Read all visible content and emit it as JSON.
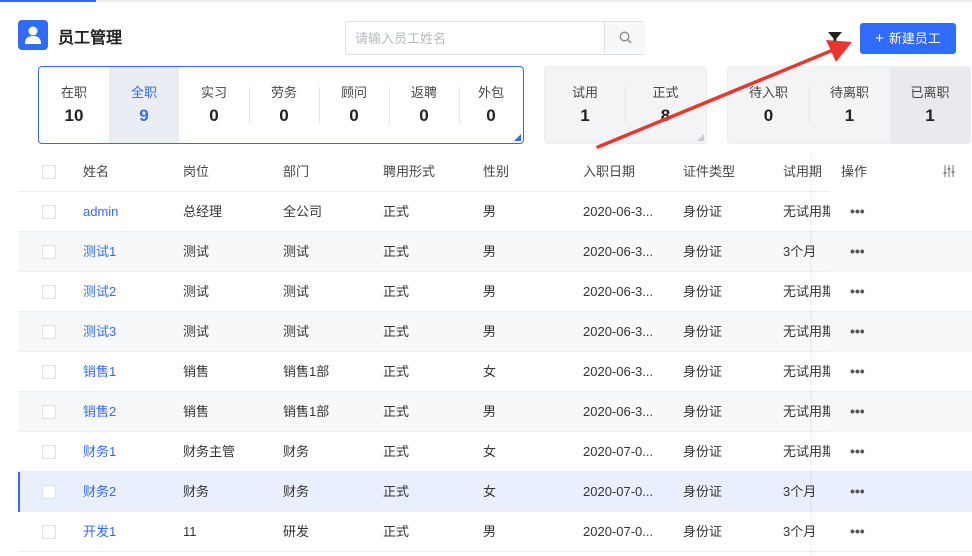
{
  "header": {
    "title": "员工管理",
    "search_placeholder": "请输入员工姓名",
    "new_button_label": "新建员工"
  },
  "stats": {
    "group1": [
      {
        "label": "在职",
        "value": "10"
      },
      {
        "label": "全职",
        "value": "9"
      },
      {
        "label": "实习",
        "value": "0"
      },
      {
        "label": "劳务",
        "value": "0"
      },
      {
        "label": "顾问",
        "value": "0"
      },
      {
        "label": "返聘",
        "value": "0"
      },
      {
        "label": "外包",
        "value": "0"
      }
    ],
    "group2": [
      {
        "label": "试用",
        "value": "1"
      },
      {
        "label": "正式",
        "value": "8"
      }
    ],
    "group3": [
      {
        "label": "待入职",
        "value": "0"
      },
      {
        "label": "待离职",
        "value": "1"
      },
      {
        "label": "已离职",
        "value": "1"
      }
    ]
  },
  "table": {
    "columns": [
      "姓名",
      "岗位",
      "部门",
      "聘用形式",
      "性别",
      "入职日期",
      "证件类型",
      "试用期",
      "操作"
    ],
    "rows": [
      [
        "admin",
        "总经理",
        "全公司",
        "正式",
        "男",
        "2020-06-3...",
        "身份证",
        "无试用期"
      ],
      [
        "测试1",
        "测试",
        "测试",
        "正式",
        "男",
        "2020-06-3...",
        "身份证",
        "3个月"
      ],
      [
        "测试2",
        "测试",
        "测试",
        "正式",
        "男",
        "2020-06-3...",
        "身份证",
        "无试用期"
      ],
      [
        "测试3",
        "测试",
        "测试",
        "正式",
        "男",
        "2020-06-3...",
        "身份证",
        "无试用期"
      ],
      [
        "销售1",
        "销售",
        "销售1部",
        "正式",
        "女",
        "2020-06-3...",
        "身份证",
        "无试用期"
      ],
      [
        "销售2",
        "销售",
        "销售1部",
        "正式",
        "男",
        "2020-06-3...",
        "身份证",
        "无试用期"
      ],
      [
        "财务1",
        "财务主管",
        "财务",
        "正式",
        "女",
        "2020-07-0...",
        "身份证",
        "无试用期"
      ],
      [
        "财务2",
        "财务",
        "财务",
        "正式",
        "女",
        "2020-07-0...",
        "身份证",
        "3个月"
      ],
      [
        "开发1",
        "11",
        "研发",
        "正式",
        "男",
        "2020-07-0...",
        "身份证",
        "3个月"
      ]
    ],
    "row_action": "•••"
  },
  "colors": {
    "accent": "#2f6bff",
    "arrow": "#e8372f"
  },
  "icons": [
    "user-icon",
    "search-icon",
    "filter-icon",
    "plus-icon",
    "column-settings-icon",
    "more-icon"
  ]
}
